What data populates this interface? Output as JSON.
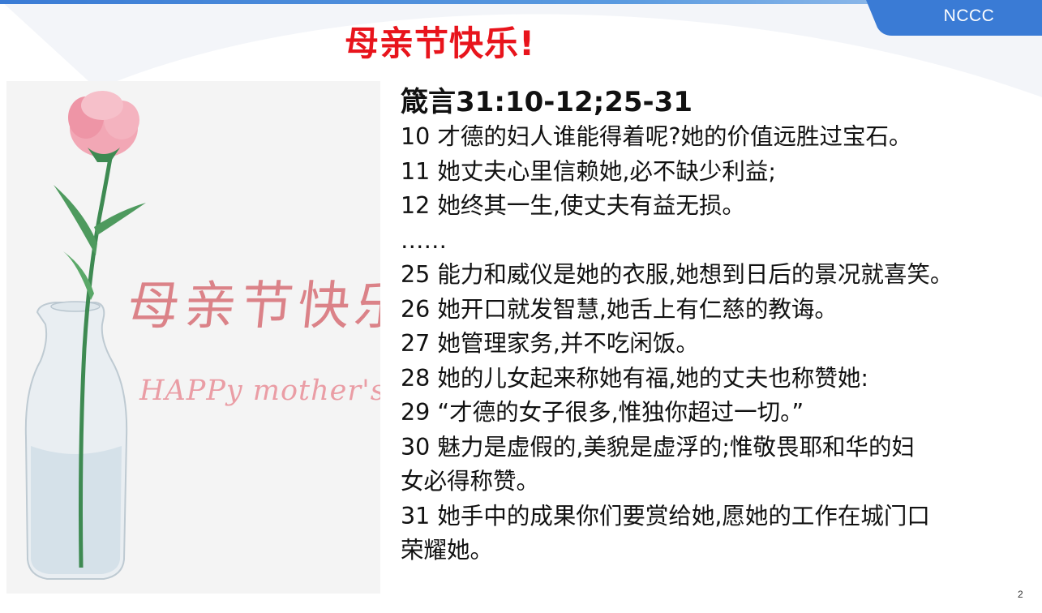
{
  "header": {
    "title": "母亲节快乐!",
    "brand": "NCCC"
  },
  "image": {
    "title_zh": "母亲节快乐",
    "title_en": "HAPPy mother's day"
  },
  "scripture": {
    "reference": "箴言31:10-12;25-31",
    "verses": [
      "10 才德的妇人谁能得着呢?她的价值远胜过宝石。",
      "11 她丈夫心里信赖她,必不缺少利益;",
      "12 她终其一生,使丈夫有益无损。",
      "……",
      "25 能力和威仪是她的衣服,她想到日后的景况就喜笑。",
      "26 她开口就发智慧,她舌上有仁慈的教诲。",
      "27 她管理家务,并不吃闲饭。",
      "28 她的儿女起来称她有福,她的丈夫也称赞她:",
      "29 “才德的女子很多,惟独你超过一切。”",
      "30 魅力是虚假的,美貌是虚浮的;惟敬畏耶和华的妇",
      "女必得称赞。",
      "31 她手中的成果你们要赏给她,愿她的工作在城门口",
      "荣耀她。"
    ]
  },
  "footer": {
    "page_number": "2"
  },
  "colors": {
    "title": "#e8141c",
    "accent_blue": "#3a7bd5",
    "image_text": "#d9797f"
  }
}
